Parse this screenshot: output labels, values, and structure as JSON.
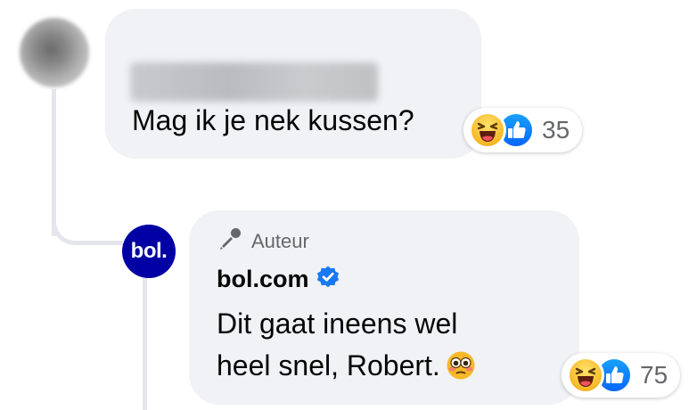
{
  "comment": {
    "author_redacted": true,
    "text": "Mag ik je nek kussen?",
    "reactions": {
      "icons": [
        "haha-icon",
        "like-icon"
      ],
      "count": "35"
    }
  },
  "reply": {
    "author_badge": "Auteur",
    "author_name": "bol.com",
    "verified": true,
    "avatar_logo": "bol.",
    "text_line1": "Dit gaat ineens wel",
    "text_line2": "heel snel, Robert.",
    "text_emoji": "flushed-face-emoji",
    "reactions": {
      "icons": [
        "haha-icon",
        "like-icon"
      ],
      "count": "75"
    }
  },
  "colors": {
    "bubble": "#f0f2f5",
    "secondary_text": "#65676b",
    "bol_brand": "#0000a4",
    "verified_blue": "#1877f2",
    "like_blue": "#0866ff",
    "haha_yellow": "#f7b928"
  }
}
